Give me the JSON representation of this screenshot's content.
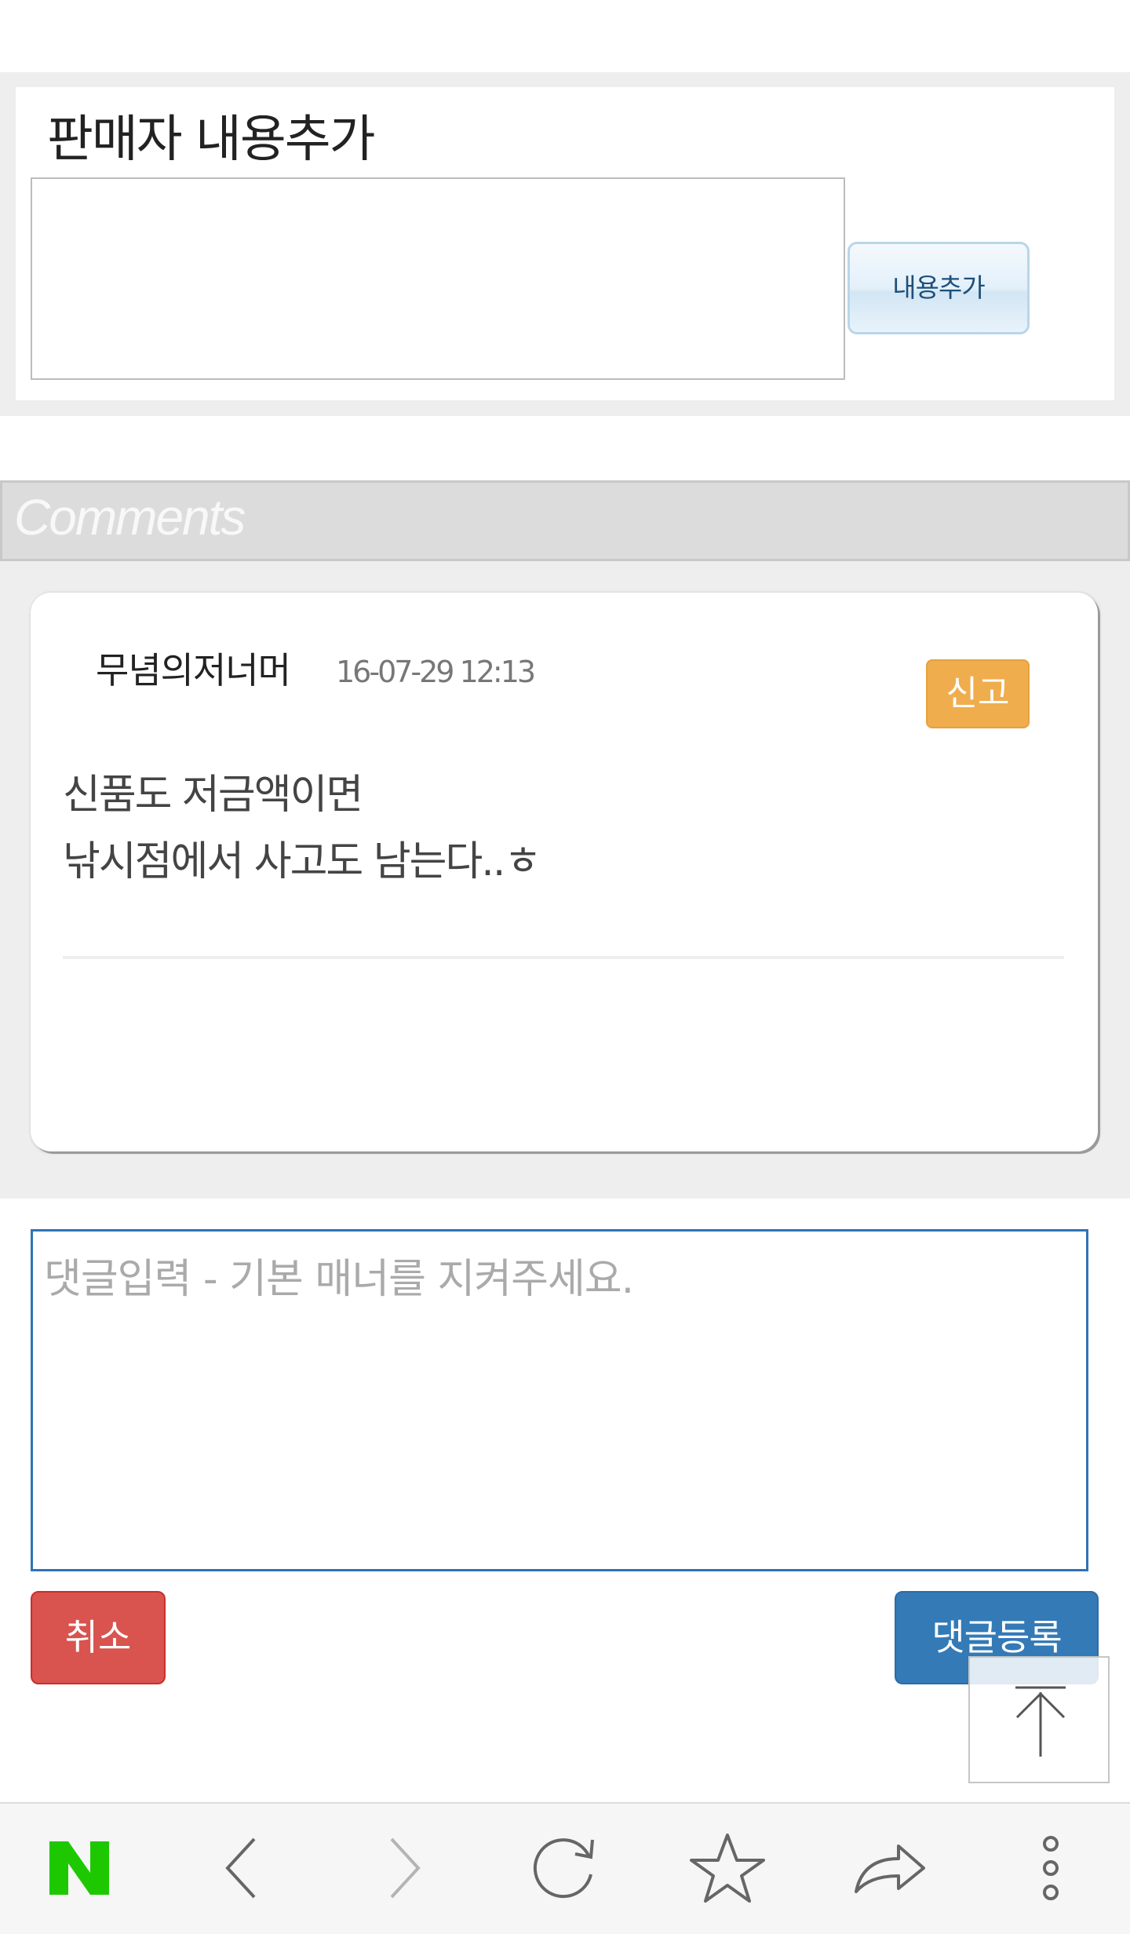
{
  "seller": {
    "title": "판매자 내용추가",
    "textarea_value": "",
    "add_button_label": "내용추가"
  },
  "comments": {
    "header_title": "Comments",
    "items": [
      {
        "author": "무념의저너머",
        "date": "16-07-29 12:13",
        "report_label": "신고",
        "lines": [
          "신품도 저금액이면",
          "낚시점에서 사고도 남는다..ㅎ"
        ]
      }
    ]
  },
  "reply": {
    "placeholder": "댓글입력 - 기본 매너를 지켜주세요.",
    "value": "",
    "cancel_label": "취소",
    "submit_label": "댓글등록"
  },
  "toolbar": {
    "icons": [
      "naver-logo-icon",
      "back-arrow-icon",
      "forward-arrow-icon",
      "reload-icon",
      "bookmark-star-icon",
      "share-icon",
      "more-menu-icon"
    ],
    "logo_color": "#1ec800"
  },
  "scroll_top": {
    "icon": "arrow-up-icon"
  }
}
